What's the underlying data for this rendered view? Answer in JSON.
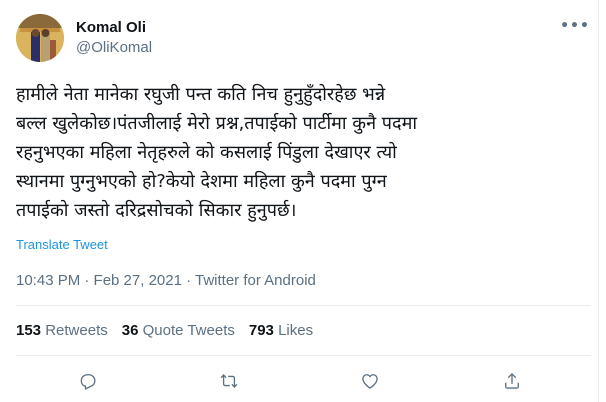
{
  "author": {
    "name": "Komal Oli",
    "handle": "@OliKomal"
  },
  "tweet": {
    "text": "हामीले नेता मानेका रघुजी पन्त कति निच हुनुहुँदोरहेछ भन्ने\nबल्ल खुलेकोछ।पंतजीलाई मेरो प्रश्न,तपाईको पार्टीमा कुनै पदमा\nरहनुभएका महिला नेतृहरुले को कसलाई पिंडुला देखाएर त्यो\nस्थानमा पुग्नुभएको हो?केयो देशमा महिला कुनै पदमा पुग्न\nतपाईको जस्तो दरिद्रसोचको सिकार हुनुपर्छ।",
    "translate_label": "Translate Tweet",
    "meta": "10:43 PM · Feb 27, 2021 · Twitter for Android"
  },
  "stats": {
    "retweets_count": "153",
    "retweets_label": "Retweets",
    "quotes_count": "36",
    "quotes_label": "Quote Tweets",
    "likes_count": "793",
    "likes_label": "Likes"
  },
  "icons": {
    "more": "more-icon",
    "reply": "reply-icon",
    "retweet": "retweet-icon",
    "like": "like-icon",
    "share": "share-icon"
  },
  "colors": {
    "link": "#1b95e0",
    "secondary_text": "#5b7083",
    "divider": "#e6ecf0"
  }
}
